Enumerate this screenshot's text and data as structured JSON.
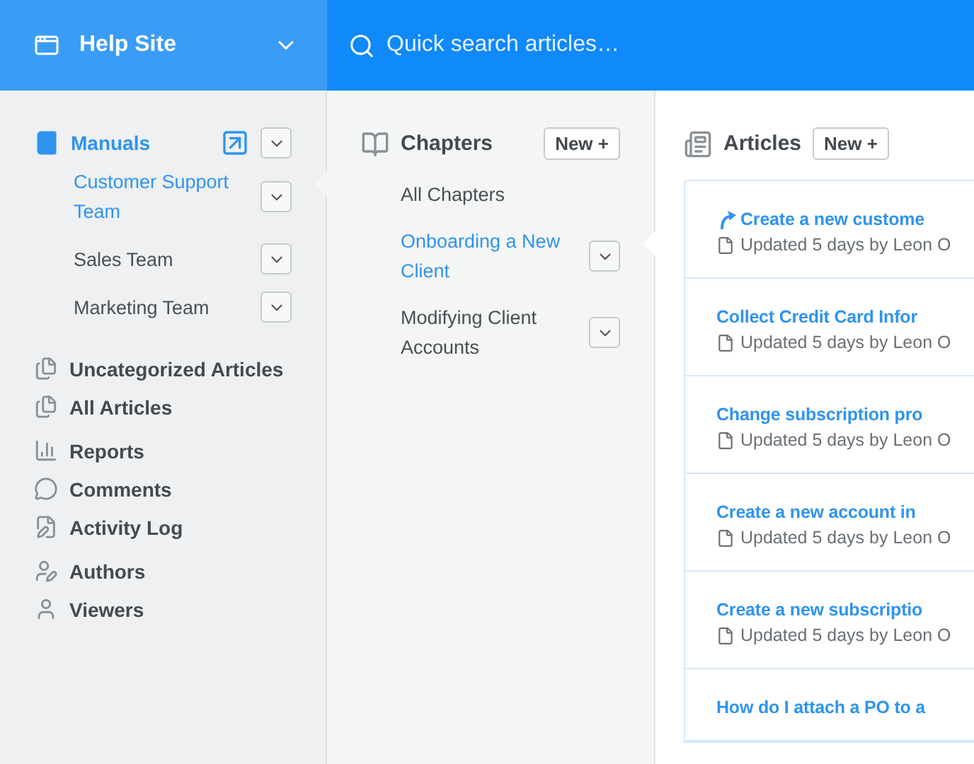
{
  "header": {
    "site": "Help Site",
    "search": {
      "placeholder": "Quick search articles…"
    }
  },
  "sidebar": {
    "groups": [
      [
        {
          "label": "Manuals",
          "selected": true,
          "children": [
            {
              "label": "Customer Support Team",
              "selected": true
            },
            {
              "label": "Sales Team",
              "selected": false
            },
            {
              "label": "Marketing Team",
              "selected": false
            }
          ]
        }
      ],
      [
        {
          "label": "Uncategorized Articles",
          "selected": false
        },
        {
          "label": "All Articles",
          "selected": false
        }
      ],
      [
        {
          "label": "Reports",
          "selected": false
        },
        {
          "label": "Comments",
          "selected": false
        },
        {
          "label": "Activity Log",
          "selected": false
        }
      ],
      [
        {
          "label": "Authors",
          "selected": false
        },
        {
          "label": "Viewers",
          "selected": false
        }
      ]
    ]
  },
  "chapters": {
    "title": "Chapters",
    "new_button": "New +",
    "items": [
      {
        "label": "All Chapters",
        "selected": false,
        "menu": false
      },
      {
        "label": "Onboarding a New Client",
        "selected": true,
        "menu": true
      },
      {
        "label": "Modifying Client Accounts",
        "selected": false,
        "menu": true
      }
    ]
  },
  "articles": {
    "title": "Articles",
    "new_button": "New +",
    "items": [
      {
        "title": "Create a new custome",
        "meta": "Updated 5 days by Leon O",
        "linked": true
      },
      {
        "title": "Collect Credit Card Infor",
        "meta": "Updated 5 days by Leon O",
        "linked": false
      },
      {
        "title": "Change subscription pro",
        "meta": "Updated 5 days by Leon O",
        "linked": false
      },
      {
        "title": "Create a new account in",
        "meta": "Updated 5 days by Leon O",
        "linked": false
      },
      {
        "title": "Create a new subscriptio",
        "meta": "Updated 5 days by Leon O",
        "linked": false
      },
      {
        "title": "How do I attach a PO to a",
        "linked": false
      }
    ]
  }
}
